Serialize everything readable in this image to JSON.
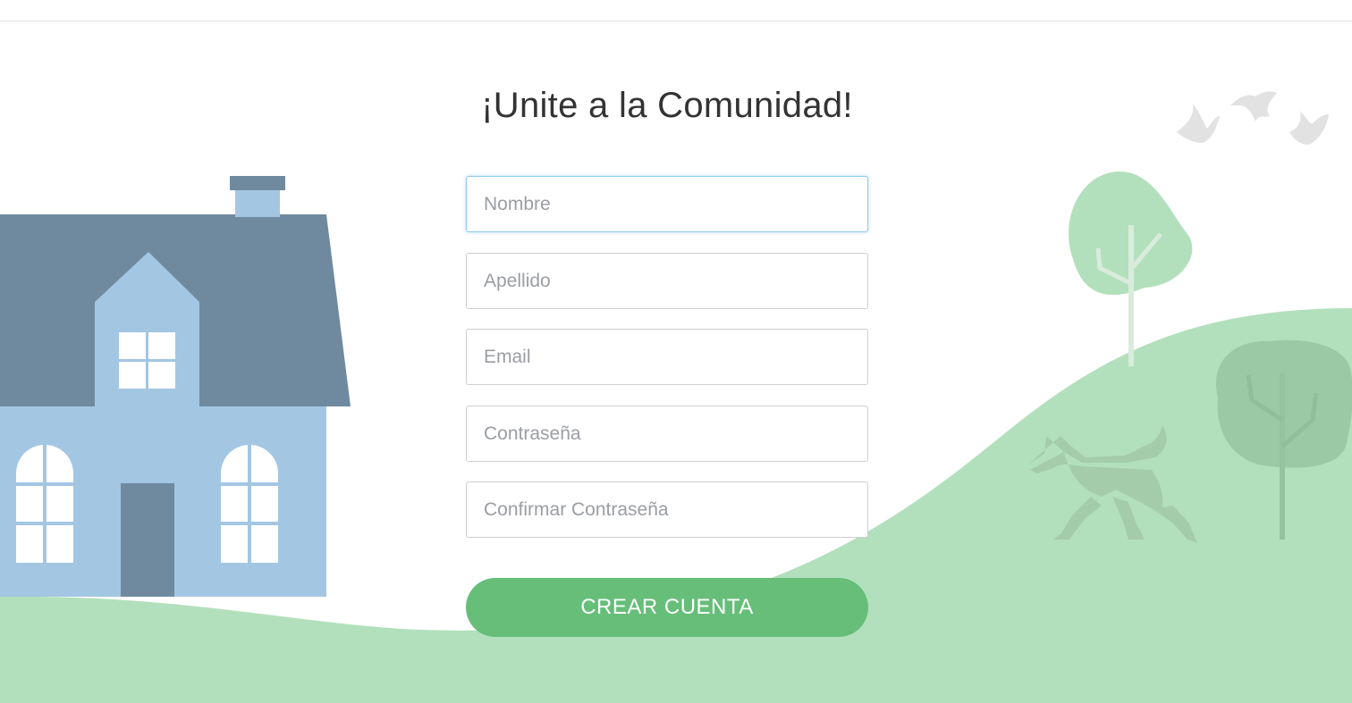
{
  "page": {
    "title": "¡Unite a la Comunidad!"
  },
  "form": {
    "fields": [
      {
        "name": "nombre",
        "placeholder": "Nombre",
        "value": ""
      },
      {
        "name": "apellido",
        "placeholder": "Apellido",
        "value": ""
      },
      {
        "name": "email",
        "placeholder": "Email",
        "value": ""
      },
      {
        "name": "contrasena",
        "placeholder": "Contraseña",
        "value": ""
      },
      {
        "name": "confirmar",
        "placeholder": "Confirmar Contraseña",
        "value": ""
      }
    ],
    "submit_label": "CREAR CUENTA"
  },
  "illustration": {
    "icons": [
      "house-icon",
      "tree-icon",
      "dog-icon",
      "bird-icon"
    ],
    "colors": {
      "hill": "#b2e0bc",
      "house_wall": "#a3c6e3",
      "house_roof": "#6f8a9e",
      "tree": "#9cd4a9",
      "dog": "#a5ccaa",
      "birds": "#e2e2e2",
      "button": "#66be79"
    }
  }
}
